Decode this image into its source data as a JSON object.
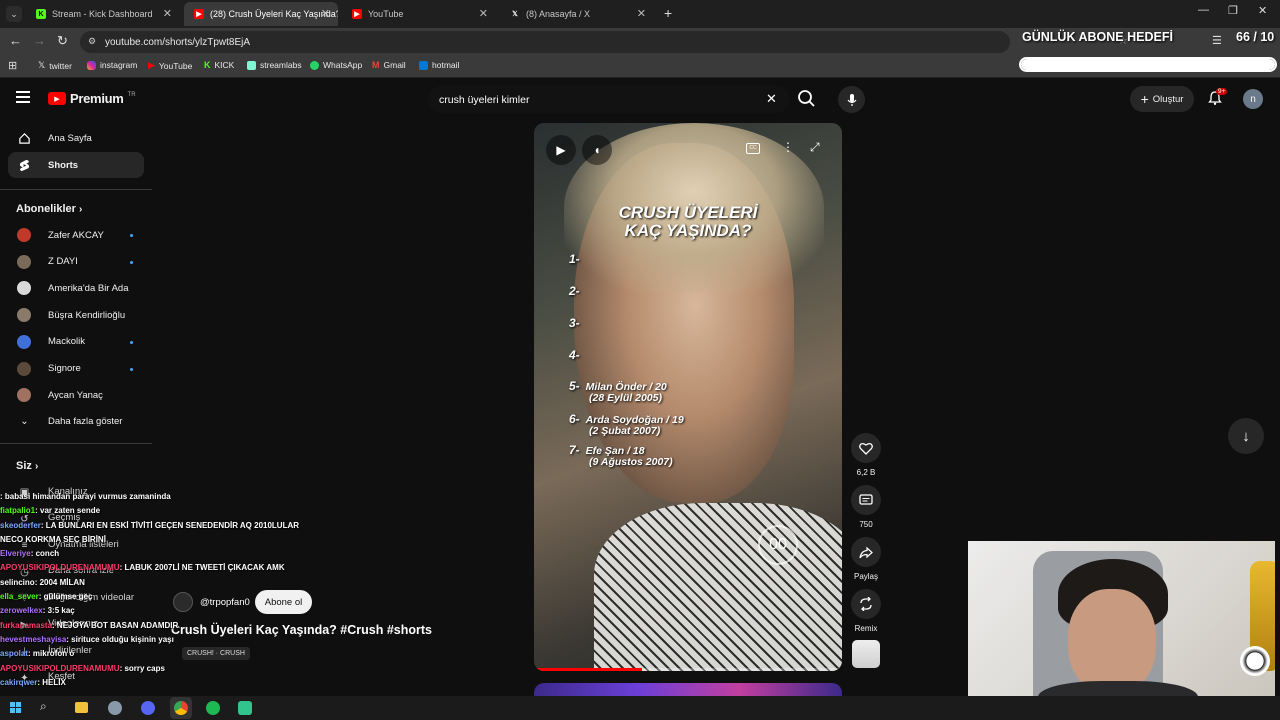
{
  "browser": {
    "tabs": [
      {
        "label": "Stream - Kick Dashboard",
        "favicon": "kick-icon",
        "color": "#53fc18"
      },
      {
        "label": "(28) Crush Üyeleri Kaç Yaşında?",
        "favicon": "youtube-icon",
        "color": "#ff0000"
      },
      {
        "label": "YouTube",
        "favicon": "youtube-icon",
        "color": "#ff0000"
      },
      {
        "label": "(8) Anasayfa / X",
        "favicon": "x-icon",
        "color": "#ffffff"
      }
    ],
    "url": "youtube.com/shorts/ylzTpwt8EjA",
    "bookmarks": [
      {
        "label": "twitter",
        "icon": "x-icon"
      },
      {
        "label": "instagram",
        "icon": "instagram-icon"
      },
      {
        "label": "YouTube",
        "icon": "youtube-icon"
      },
      {
        "label": "KICK",
        "icon": "kick-icon"
      },
      {
        "label": "streamlabs",
        "icon": "streamlabs-icon"
      },
      {
        "label": "WhatsApp",
        "icon": "whatsapp-icon"
      },
      {
        "label": "Gmail",
        "icon": "gmail-icon"
      },
      {
        "label": "hotmail",
        "icon": "hotmail-icon"
      }
    ]
  },
  "overlay": {
    "goal_title": "GÜNLÜK ABONE HEDEFİ",
    "goal_count": "66 / 10",
    "goal_progress": 1.0
  },
  "youtube": {
    "logo": "Premium",
    "logo_badge": "TR",
    "search_value": "crush üyeleri kimler",
    "create_label": "Oluştur",
    "notif_count": "9+",
    "avatar_letter": "n",
    "sidebar": {
      "home": "Ana Sayfa",
      "shorts": "Shorts",
      "subs_title": "Abonelikler",
      "subscriptions": [
        {
          "name": "Zafer AKCAY",
          "dot": true,
          "color": "#c0392b"
        },
        {
          "name": "Z DAYI",
          "dot": true,
          "color": "#7a6a5a"
        },
        {
          "name": "Amerika'da Bir Ada",
          "dot": false,
          "color": "#d9d9d9"
        },
        {
          "name": "Büşra Kendirlioğlu",
          "dot": false,
          "color": "#8a7a6a"
        },
        {
          "name": "Mackolik",
          "dot": true,
          "color": "#3f6fd8"
        },
        {
          "name": "Signore",
          "dot": true,
          "color": "#5b4a3a"
        },
        {
          "name": "Aycan Yanaç",
          "dot": false,
          "color": "#a07060"
        }
      ],
      "show_more": "Daha fazla göster",
      "you_title": "Siz",
      "you_items": [
        "Kanalınız",
        "Geçmiş",
        "Oynatma listeleri",
        "Daha sonra izle",
        "Beğendiğim videolar",
        "Videolarınız",
        "İndirilenler",
        "Kesfet"
      ]
    },
    "video": {
      "title_line1": "CRUSH ÜYELERİ",
      "title_line2": "KAÇ YAŞINDA?",
      "list": [
        {
          "num": "1-",
          "name": "",
          "date": ""
        },
        {
          "num": "2-",
          "name": "",
          "date": ""
        },
        {
          "num": "3-",
          "name": "",
          "date": ""
        },
        {
          "num": "4-",
          "name": "",
          "date": ""
        },
        {
          "num": "5-",
          "name": "Milan Önder / 20",
          "date": "(28 Eylül 2005)"
        },
        {
          "num": "6-",
          "name": "Arda Soydoğan / 19",
          "date": "(2 Şubat 2007)"
        },
        {
          "num": "7-",
          "name": "Efe Şan / 18",
          "date": "(9 Ağustos 2007)"
        }
      ],
      "timer": "00",
      "channel": "@trpopfan0",
      "subscribe": "Abone ol",
      "title": "Crush Üyeleri Kaç Yaşında? #Crush #shorts",
      "audio": "CRUSH! · CRUSH",
      "progress": 0.35
    },
    "actions": {
      "likes": "6,2 B",
      "comments": "750",
      "share": "Paylaş",
      "remix": "Remix"
    }
  },
  "chat": [
    {
      "user": "",
      "text": ": babasi himandan parayi vurmus zamaninda",
      "color": "#ffffff"
    },
    {
      "user": "fiatpalio1",
      "text": ": var zaten sende",
      "color": "#53fc18"
    },
    {
      "user": "skeoderfer",
      "text": ": LA BUNLARI EN ESKİ TİVİTİ GEÇEN SENEDENDİR AQ 2010LULAR NECO KORKMA SEÇ BİRİNİ",
      "color": "#7aa6ff"
    },
    {
      "user": "Elveriye",
      "text": ": conch",
      "color": "#b070ff"
    },
    {
      "user": "APOYUSIKIPOLDURENAMUMU",
      "text": ": LABUK 2007Lİ NE TWEETİ ÇIKACAK AMK",
      "color": "#ff3b6b"
    },
    {
      "user": "selincino",
      "text": ": 2004 MİLAN",
      "color": "#ffffff"
    },
    {
      "user": "ella_sever",
      "text": ": gülümse geç",
      "color": "#53fc18"
    },
    {
      "user": "zerowelkex",
      "text": ": 3:5 kaç",
      "color": "#b070ff"
    },
    {
      "user": "furkanamasta",
      "text": ": NEJOYA BOT BASAN ADAMDIR",
      "color": "#ff3b6b"
    },
    {
      "user": "hevestmeshayisa",
      "text": ": sirituce olduğu kişinin yaşı",
      "color": "#b070ff"
    },
    {
      "user": "aspolat",
      "text": ": mikrofon o",
      "color": "#7aa6ff"
    },
    {
      "user": "APOYUSIKIPOLDURENAMUMU",
      "text": ": sorry caps",
      "color": "#ff3b6b"
    },
    {
      "user": "cakirqwer",
      "text": ": HELİX",
      "color": "#7aa6ff"
    }
  ]
}
